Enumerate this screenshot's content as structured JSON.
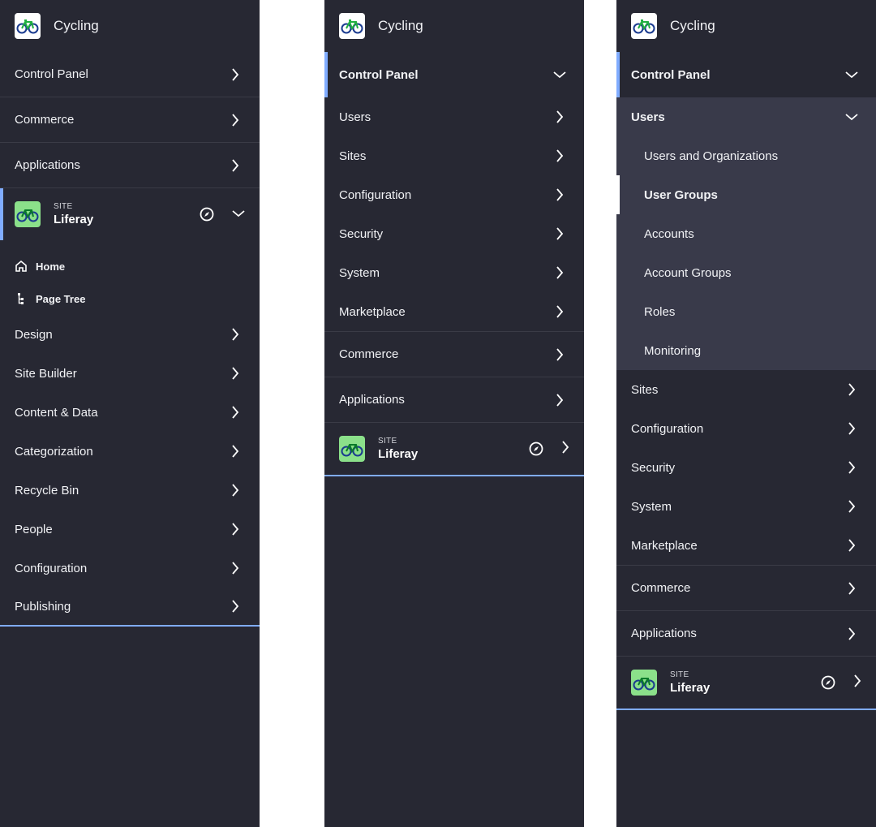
{
  "brand": "Cycling",
  "site": {
    "kicker": "SITE",
    "name": "Liferay"
  },
  "panel1": {
    "top_items": [
      "Control Panel",
      "Commerce",
      "Applications"
    ],
    "site_links": [
      "Home",
      "Page Tree"
    ],
    "site_items": [
      "Design",
      "Site Builder",
      "Content & Data",
      "Categorization",
      "Recycle Bin",
      "People",
      "Configuration",
      "Publishing"
    ]
  },
  "panel2": {
    "control_panel": "Control Panel",
    "cp_items": [
      "Users",
      "Sites",
      "Configuration",
      "Security",
      "System",
      "Marketplace"
    ],
    "bottom_items": [
      "Commerce",
      "Applications"
    ]
  },
  "panel3": {
    "control_panel": "Control Panel",
    "users": "Users",
    "user_items": [
      "Users and Organizations",
      "User Groups",
      "Accounts",
      "Account Groups",
      "Roles",
      "Monitoring"
    ],
    "cp_items": [
      "Sites",
      "Configuration",
      "Security",
      "System",
      "Marketplace"
    ],
    "bottom_items": [
      "Commerce",
      "Applications"
    ]
  },
  "colors": {
    "panel_bg": "#272833",
    "accent": "#80acff",
    "group_bg": "#393a4a"
  }
}
